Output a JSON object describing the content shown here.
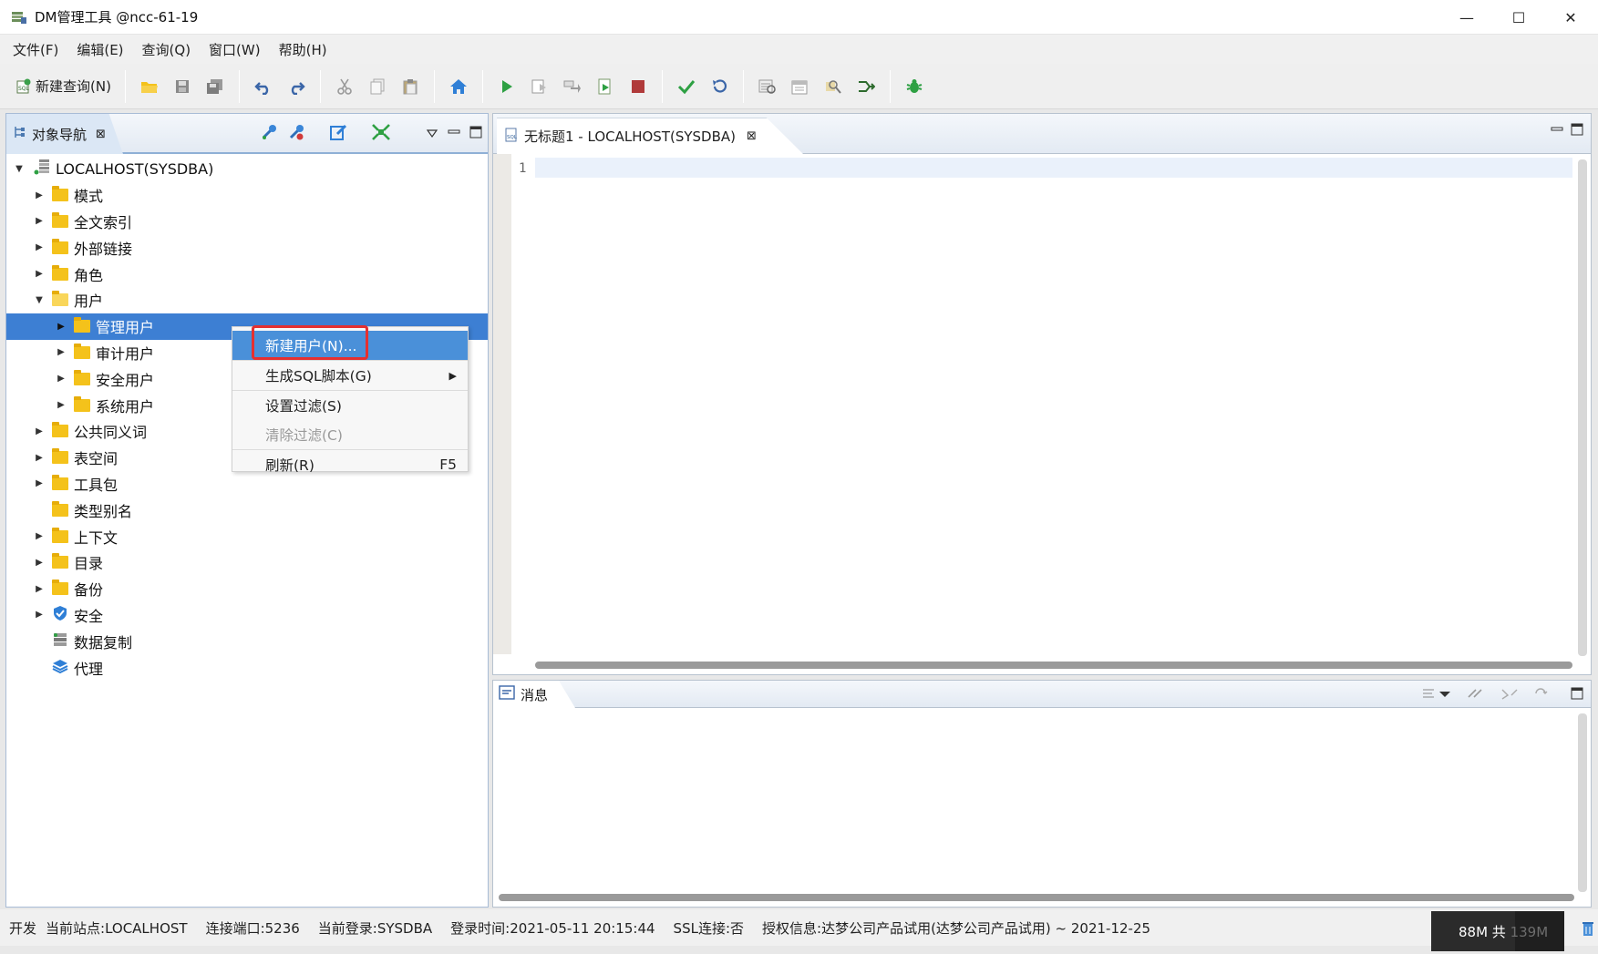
{
  "window": {
    "title": "DM管理工具 @ncc-61-19",
    "minimize": "—",
    "maximize": "☐",
    "close": "✕"
  },
  "menubar": [
    "文件(F)",
    "编辑(E)",
    "查询(Q)",
    "窗口(W)",
    "帮助(H)"
  ],
  "toolbar": {
    "new_query_label": "新建查询(N)"
  },
  "navigator": {
    "tab_label": "对象导航",
    "root": "LOCALHOST(SYSDBA)",
    "items": [
      {
        "label": "模式",
        "level": 1,
        "expanded": false
      },
      {
        "label": "全文索引",
        "level": 1,
        "expanded": false
      },
      {
        "label": "外部链接",
        "level": 1,
        "expanded": false
      },
      {
        "label": "角色",
        "level": 1,
        "expanded": false
      },
      {
        "label": "用户",
        "level": 1,
        "expanded": true
      },
      {
        "label": "管理用户",
        "level": 2,
        "expanded": false,
        "selected": true
      },
      {
        "label": "审计用户",
        "level": 2,
        "expanded": false
      },
      {
        "label": "安全用户",
        "level": 2,
        "expanded": false
      },
      {
        "label": "系统用户",
        "level": 2,
        "expanded": false
      },
      {
        "label": "公共同义词",
        "level": 1,
        "expanded": false
      },
      {
        "label": "表空间",
        "level": 1,
        "expanded": false
      },
      {
        "label": "工具包",
        "level": 1,
        "expanded": false
      },
      {
        "label": "类型别名",
        "level": 1,
        "leaf": true
      },
      {
        "label": "上下文",
        "level": 1,
        "expanded": false
      },
      {
        "label": "目录",
        "level": 1,
        "expanded": false
      },
      {
        "label": "备份",
        "level": 1,
        "expanded": false
      },
      {
        "label": "安全",
        "level": 1,
        "expanded": false,
        "icon": "shield-icon"
      },
      {
        "label": "数据复制",
        "level": 1,
        "leaf": true,
        "icon": "replication-icon"
      },
      {
        "label": "代理",
        "level": 1,
        "leaf": true,
        "icon": "layers-icon"
      }
    ]
  },
  "context_menu": {
    "new_user": "新建用户(N)...",
    "generate_sql": "生成SQL脚本(G)",
    "set_filter": "设置过滤(S)",
    "clear_filter": "清除过滤(C)",
    "refresh": "刷新(R)",
    "refresh_shortcut": "F5"
  },
  "editor": {
    "tab_label": "无标题1 - LOCALHOST(SYSDBA)",
    "line_number": "1"
  },
  "messages": {
    "tab_label": "消息"
  },
  "statusbar": {
    "mode": "开发",
    "site": "当前站点:LOCALHOST",
    "port": "连接端口:5236",
    "login": "当前登录:SYSDBA",
    "login_time": "登录时间:2021-05-11 20:15:44",
    "ssl": "SSL连接:否",
    "license": "授权信息:达梦公司产品试用(达梦公司产品试用) ~ 2021-12-25",
    "memory_used": "88M 共 ",
    "memory_total": "139M",
    "memory_fraction": 0.63
  },
  "colors": {
    "selection": "#3d7fd3",
    "menu_active": "#4a90d9",
    "highlight_box": "#e53030",
    "folder": "#f4c21b",
    "run_green": "#2ea043",
    "stop_red": "#b03a3a",
    "home_blue": "#2f7fd6"
  }
}
